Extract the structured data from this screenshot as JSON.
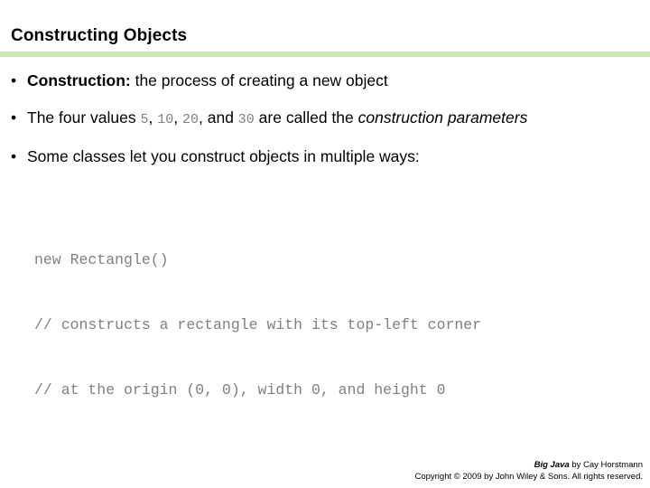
{
  "slide": {
    "title": "Constructing Objects",
    "rule_color": "#cde5b2",
    "background_color": "#ffffff",
    "code_color": "#808080",
    "bullets": [
      {
        "marker": "•",
        "term": "Construction:",
        "rest": " the process of creating a new object"
      },
      {
        "marker": "•",
        "lead": "The four values ",
        "value1": "5",
        "sep1": ", ",
        "value2": "10",
        "sep2": ", ",
        "value3": "20",
        "sep3": ", and ",
        "value4": "30",
        "mid": " are called the ",
        "emph": "construction parameters"
      },
      {
        "marker": "•",
        "text": "Some classes let you construct objects in multiple ways:"
      }
    ],
    "code_lines": [
      "new Rectangle()",
      "// constructs a rectangle with its top-left corner",
      "// at the origin (0, 0), width 0, and height 0"
    ]
  },
  "footer": {
    "book": "Big Java",
    "byline": " by Cay Horstmann",
    "copyright": "Copyright © 2009 by John Wiley & Sons.  All rights reserved."
  }
}
